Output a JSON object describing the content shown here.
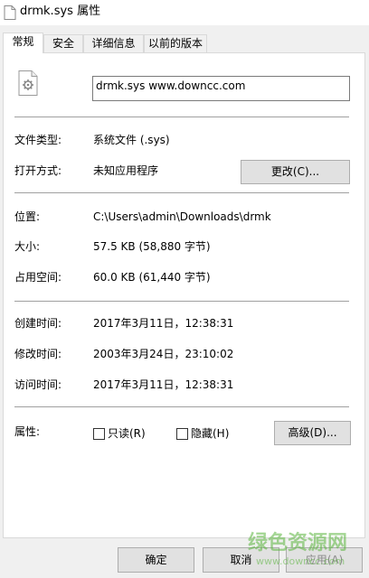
{
  "window": {
    "title": "drmk.sys 属性"
  },
  "tabs": [
    {
      "label": "常规",
      "active": true
    },
    {
      "label": "安全"
    },
    {
      "label": "详细信息"
    },
    {
      "label": "以前的版本"
    }
  ],
  "general": {
    "file_name": "drmk.sys    www.downcc.com",
    "file_type_label": "文件类型:",
    "file_type_value": "系统文件 (.sys)",
    "opens_with_label": "打开方式:",
    "opens_with_value": "未知应用程序",
    "change_button": "更改(C)...",
    "location_label": "位置:",
    "location_value": "C:\\Users\\admin\\Downloads\\drmk",
    "size_label": "大小:",
    "size_value": "57.5 KB (58,880 字节)",
    "size_on_disk_label": "占用空间:",
    "size_on_disk_value": "60.0 KB (61,440 字节)",
    "created_label": "创建时间:",
    "created_value": "2017年3月11日，12:38:31",
    "modified_label": "修改时间:",
    "modified_value": "2003年3月24日，23:10:02",
    "accessed_label": "访问时间:",
    "accessed_value": "2017年3月11日，12:38:31",
    "attributes_label": "属性:",
    "readonly_label": "只读(R)",
    "readonly_checked": false,
    "hidden_label": "隐藏(H)",
    "hidden_checked": false,
    "advanced_button": "高级(D)..."
  },
  "footer": {
    "ok_button": "确定",
    "cancel_button": "取消",
    "apply_button": "应用(A)"
  },
  "watermark": {
    "text": "绿色资源网",
    "url": "www.downcc.com"
  }
}
